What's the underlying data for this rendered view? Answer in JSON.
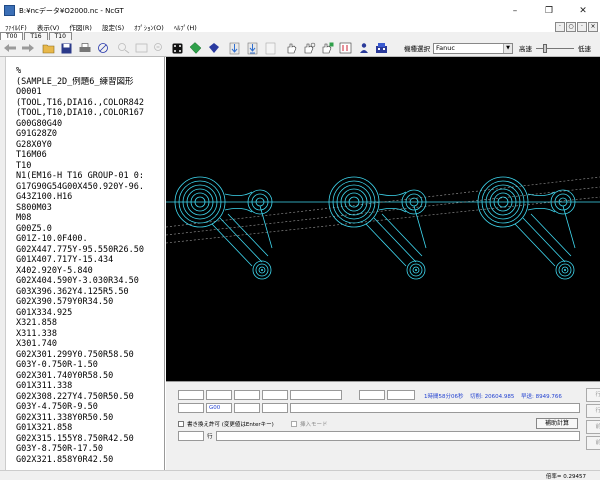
{
  "window": {
    "title": "B:¥ncデータ¥O2000.nc - NcGT",
    "minimize": "–",
    "maximize": "❐",
    "close": "✕"
  },
  "menu": {
    "items": [
      "ﾌｧｲﾙ(F)",
      "表示(V)",
      "作図(R)",
      "設定(S)",
      "ｵﾌﾟｼｮﾝ(O)",
      "ﾍﾙﾌﾟ(H)"
    ],
    "right_buttons": [
      "·",
      "○",
      "·",
      "×"
    ]
  },
  "tabs": [
    "T00",
    "T16",
    "T10"
  ],
  "toolbar": {
    "machine_label": "機種選択",
    "machine_value": "Fanuc",
    "speed_high": "高速",
    "speed_low": "低速",
    "speed_level": 0.2
  },
  "code": [
    "%",
    "(SAMPLE_2D_例題6_練習図形",
    "O0001",
    "(TOOL,T16,DIA16.,COLOR842",
    "(TOOL,T10,DIA10.,COLOR167",
    "G00G80G40",
    "G91G28Z0",
    "G28X0Y0",
    "T16M06",
    "T10",
    "N1(EM16-H T16 GROUP-01 0:",
    "G17G90G54G00X450.920Y-96.",
    "G43Z100.H16",
    "S800M03",
    "M08",
    "G00Z5.0",
    "G01Z-10.0F400.",
    "G02X447.775Y-95.550R26.50",
    "G01X407.717Y-15.434",
    "X402.920Y-5.840",
    "G02X404.590Y-3.030R34.50",
    "G03X396.362Y4.125R5.50",
    "G02X390.579Y0R34.50",
    "G01X334.925",
    "X321.858",
    "X311.338",
    "X301.740",
    "G02X301.299Y0.750R58.50",
    "G03Y-0.750R-1.50",
    "G02X301.740Y0R58.50",
    "G01X311.338",
    "G02X308.227Y4.750R50.50",
    "G03Y-4.750R-9.50",
    "G02X311.338Y0R50.50",
    "G01X321.858",
    "G02X315.155Y8.750R42.50",
    "G03Y-8.750R-17.50",
    "G02X321.858Y0R42.50"
  ],
  "bottom": {
    "g_code": "G00",
    "time": "1時間58分06秒",
    "cut_label": "切削: 20604.985",
    "fast_label": "早送: 8949.766",
    "overwrite_label": "書き換え許可 (変更値はEnterキー)",
    "insert_label": "挿入モード",
    "line_label": "行",
    "aux_calc": "補助計算",
    "side_buttons": [
      "行削",
      "行挿",
      "前の",
      "前の"
    ]
  },
  "status": {
    "scale": "倍率= 0.29457"
  },
  "colors": {
    "canvas": "#000000",
    "toolpath": "#3fd8f0",
    "rapid": "#9a9a9a",
    "info_text": "#1f3fd0"
  }
}
